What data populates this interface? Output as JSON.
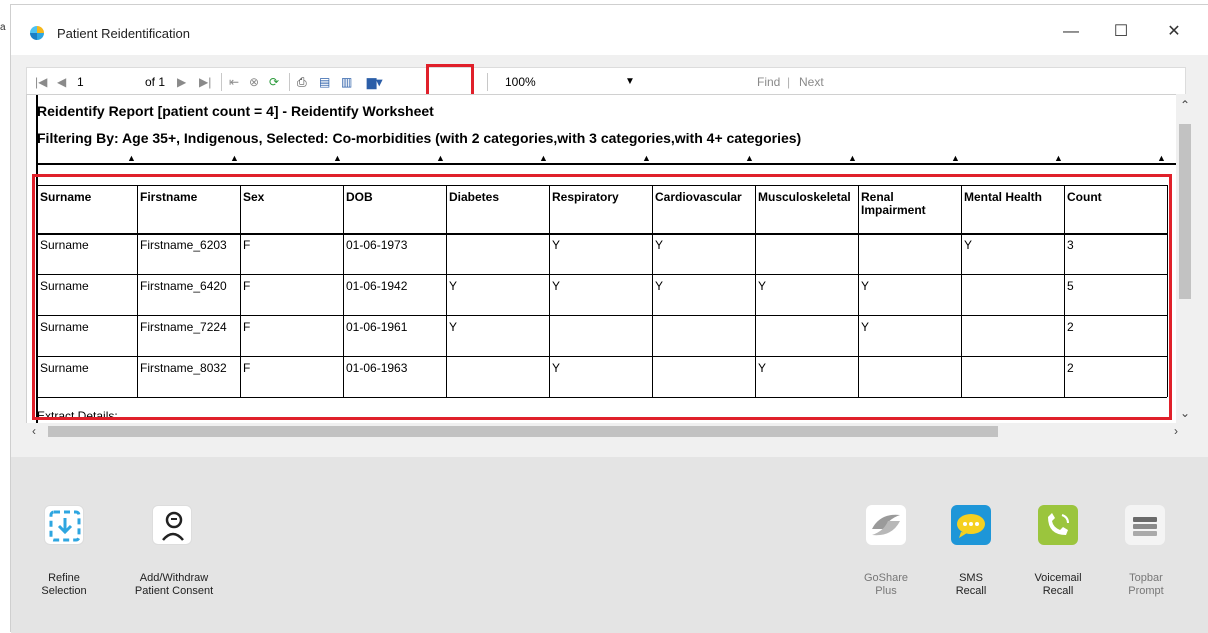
{
  "window": {
    "title": "Patient Reidentification"
  },
  "toolbar": {
    "page_current": "1",
    "page_of": "of 1",
    "zoom": "100%",
    "find": "Find",
    "next": "Next"
  },
  "report": {
    "title": "Reidentify Report  [patient count = 4] - Reidentify Worksheet",
    "filter": "Filtering By: Age 35+, Indigenous, Selected: Co-morbidities (with 2 categories,with 3 categories,with 4+ categories)",
    "columns": [
      "Surname",
      "Firstname",
      "Sex",
      "DOB",
      "Diabetes",
      "Respiratory",
      "Cardiovascular",
      "Musculoskeletal",
      "Renal Impairment",
      "Mental Health",
      "Count"
    ],
    "rows": [
      [
        "Surname",
        "Firstname_6203",
        "F",
        "01-06-1973",
        "",
        "Y",
        "Y",
        "",
        "",
        "Y",
        "3"
      ],
      [
        "Surname",
        "Firstname_6420",
        "F",
        "01-06-1942",
        "Y",
        "Y",
        "Y",
        "Y",
        "Y",
        "",
        "5"
      ],
      [
        "Surname",
        "Firstname_7224",
        "F",
        "01-06-1961",
        "Y",
        "",
        "",
        "",
        "Y",
        "",
        "2"
      ],
      [
        "Surname",
        "Firstname_8032",
        "F",
        "01-06-1963",
        "",
        "Y",
        "",
        "Y",
        "",
        "",
        "2"
      ]
    ],
    "footer_partial": "Extract Details:"
  },
  "actions": {
    "refine": "Refine Selection",
    "consent": "Add/Withdraw Patient Consent",
    "goshare": "GoShare Plus",
    "sms": "SMS Recall",
    "voicemail": "Voicemail Recall",
    "topbar": "Topbar Prompt"
  },
  "colors": {
    "highlight": "#e0202a",
    "sms_tile": "#1e96d8",
    "voicemail_tile": "#9bc53d"
  },
  "icons": [
    "first-page-icon",
    "prev-page-icon",
    "next-page-icon",
    "last-page-icon",
    "back-icon",
    "stop-icon",
    "refresh-icon",
    "print-icon",
    "print-layout-icon",
    "page-setup-icon",
    "export-save-icon",
    "zoom-dropdown-icon",
    "download-icon",
    "consent-icon",
    "goshare-icon",
    "sms-icon",
    "voicemail-icon",
    "topbar-icon"
  ]
}
